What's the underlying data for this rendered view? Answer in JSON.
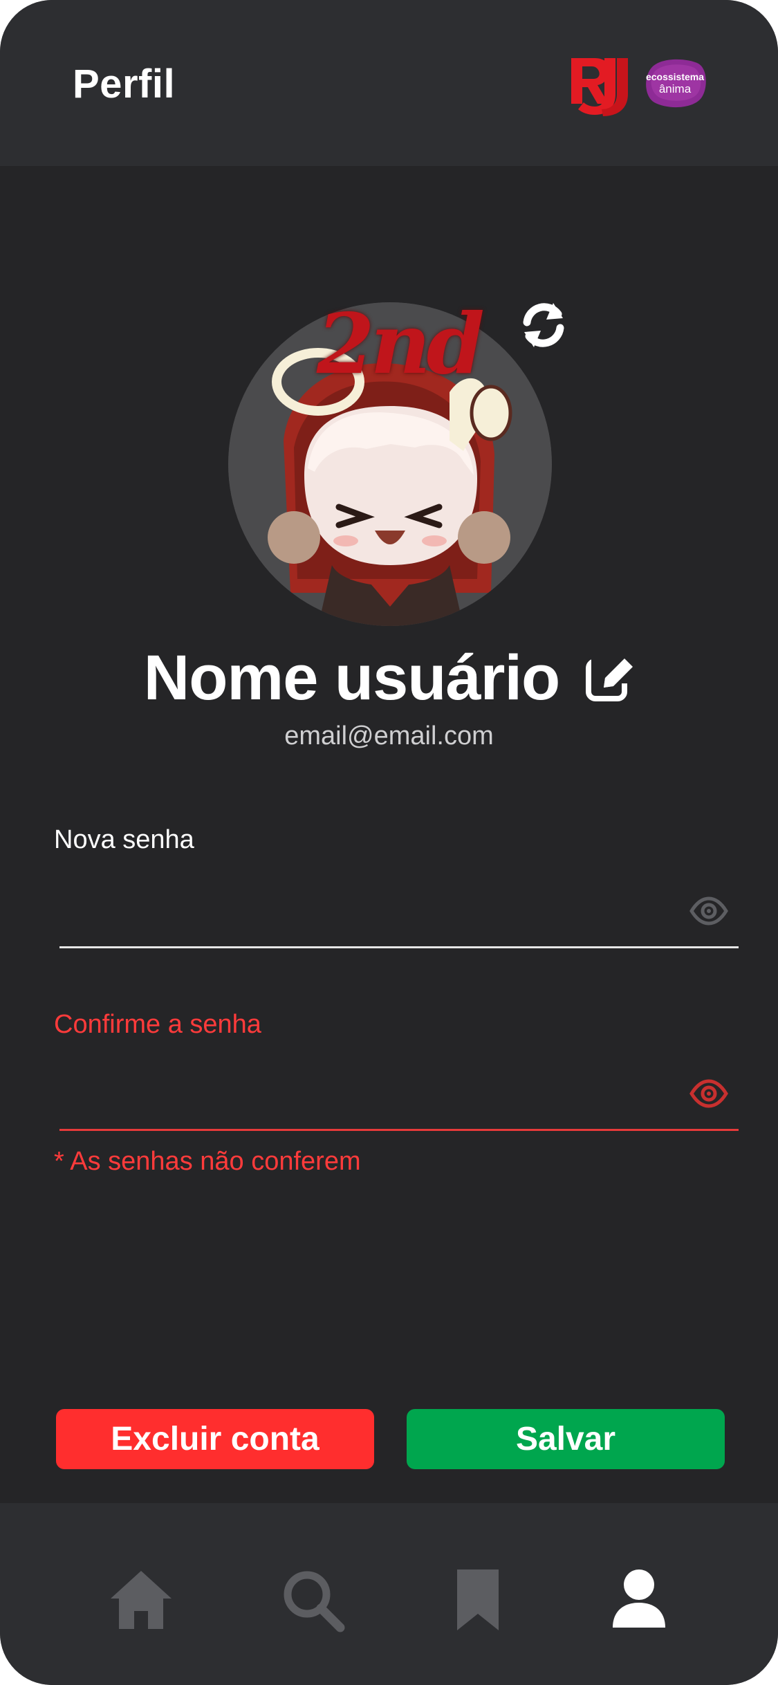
{
  "header": {
    "title": "Perfil",
    "logo_anima_line1": "ecossistema",
    "logo_anima_line2": "ânima"
  },
  "profile": {
    "avatar_badge": "2nd",
    "name": "Nome usuário",
    "email": "email@email.com"
  },
  "form": {
    "new_password": {
      "label": "Nova senha",
      "value": "",
      "placeholder": ""
    },
    "confirm_password": {
      "label": "Confirme a senha",
      "value": "",
      "placeholder": ""
    },
    "error": "* As senhas não conferem"
  },
  "actions": {
    "delete_label": "Excluir conta",
    "save_label": "Salvar"
  },
  "tabbar": {
    "items": [
      {
        "icon": "home-icon",
        "active": false
      },
      {
        "icon": "search-icon",
        "active": false
      },
      {
        "icon": "bookmark-icon",
        "active": false
      },
      {
        "icon": "profile-icon",
        "active": true
      }
    ]
  },
  "colors": {
    "background": "#252527",
    "header": "#2d2e31",
    "error": "#ff3b3b",
    "delete": "#ff2e2e",
    "save": "#00a64e",
    "inactive_icon": "#5c5d61",
    "active_icon": "#ffffff"
  }
}
